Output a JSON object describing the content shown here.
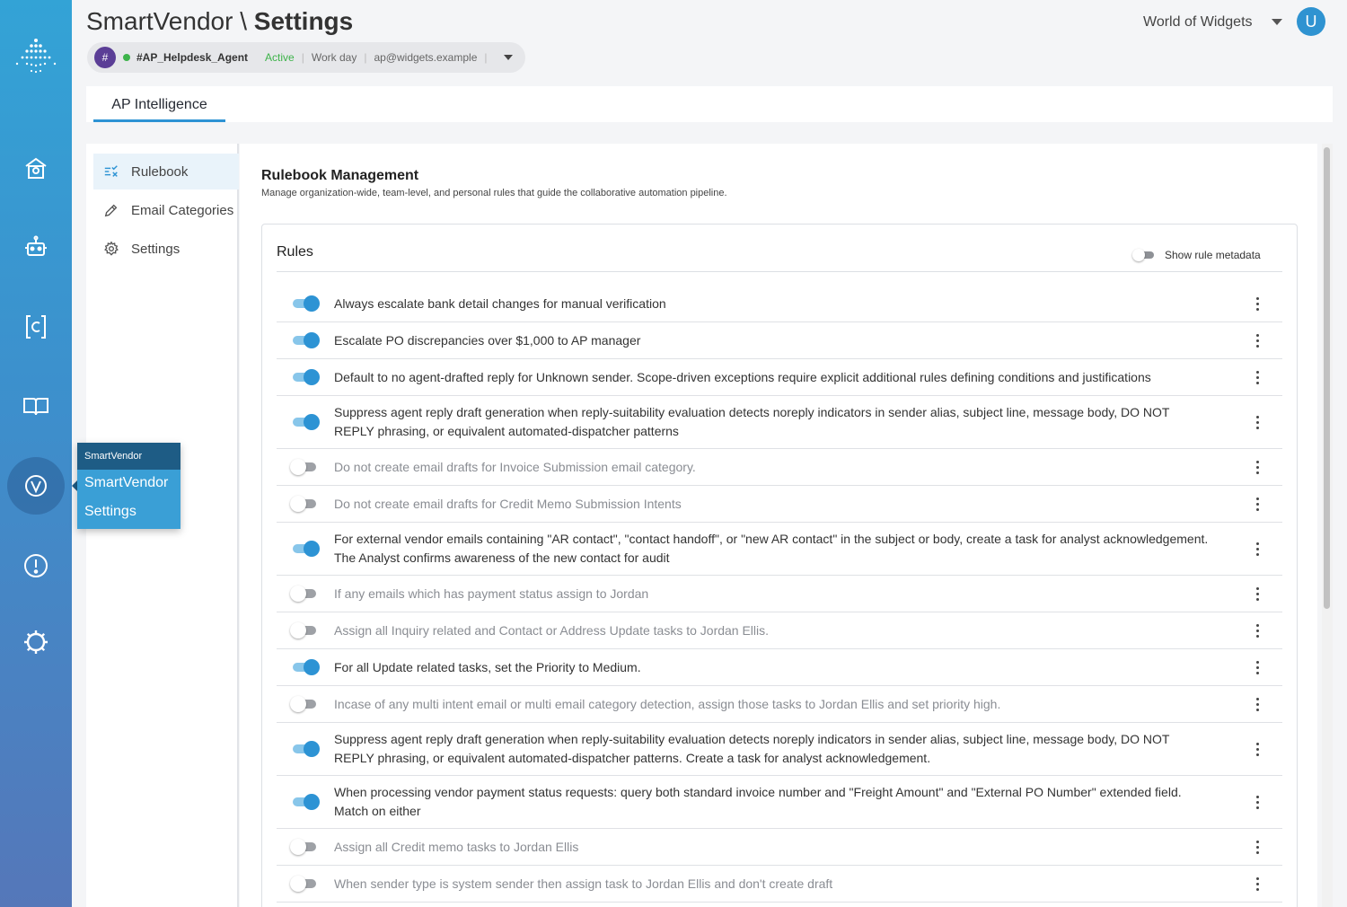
{
  "header": {
    "title_app": "SmartVendor \\",
    "title_page": "Settings",
    "org_name": "World of Widgets",
    "avatar_initial": "U"
  },
  "agent": {
    "icon": "#",
    "name": "#AP_Helpdesk_Agent",
    "status": "Active",
    "schedule": "Work day",
    "email": "ap@widgets.example",
    "sep": "|"
  },
  "tabs": [
    {
      "label": "AP Intelligence"
    }
  ],
  "submenu": [
    {
      "label": "Rulebook",
      "icon": "rulebook-icon"
    },
    {
      "label": "Email Categories",
      "icon": "pencil-icon"
    },
    {
      "label": "Settings",
      "icon": "gear-icon"
    }
  ],
  "flyout": {
    "header": "SmartVendor",
    "items": [
      "SmartVendor",
      "Settings"
    ]
  },
  "main": {
    "heading": "Rulebook Management",
    "description": "Manage organization-wide, team-level, and personal rules that guide the collaborative automation pipeline.",
    "rules_title": "Rules",
    "metadata_label": "Show rule metadata",
    "metadata_enabled": false
  },
  "rules": [
    {
      "text": "Always escalate bank detail changes for manual verification",
      "enabled": true
    },
    {
      "text": "Escalate PO discrepancies over $1,000 to AP manager",
      "enabled": true
    },
    {
      "text": "Default to no agent-drafted reply for Unknown sender. Scope-driven exceptions require explicit additional rules defining conditions and justifications",
      "enabled": true
    },
    {
      "text": "Suppress agent reply draft generation when reply-suitability evaluation detects noreply indicators in sender alias, subject line, message body, DO NOT REPLY phrasing, or equivalent automated-dispatcher patterns",
      "enabled": true
    },
    {
      "text": "Do not create email drafts for Invoice Submission email category.",
      "enabled": false
    },
    {
      "text": "Do not create email drafts for Credit Memo Submission Intents",
      "enabled": false
    },
    {
      "text": "For external vendor emails containing \"AR contact\", \"contact handoff\", or \"new AR contact\" in the subject or body, create a task for analyst acknowledgement. The Analyst confirms awareness of the new contact for audit",
      "enabled": true
    },
    {
      "text": "If any emails which has payment status assign to Jordan",
      "enabled": false
    },
    {
      "text": "Assign all Inquiry related and Contact or Address Update tasks to Jordan Ellis.",
      "enabled": false
    },
    {
      "text": "For all Update related tasks, set the Priority to Medium.",
      "enabled": true
    },
    {
      "text": "Incase of any multi intent email or multi email category detection, assign those tasks to Jordan Ellis and set priority high.",
      "enabled": false
    },
    {
      "text": "Suppress agent reply draft generation when reply-suitability evaluation detects noreply indicators in sender alias, subject line, message body, DO NOT REPLY phrasing, or equivalent automated-dispatcher patterns. Create a task for analyst acknowledgement.",
      "enabled": true
    },
    {
      "text": "When processing vendor payment status requests: query both standard invoice number and \"Freight Amount\" and \"External PO Number\" extended field. Match on either",
      "enabled": true
    },
    {
      "text": "Assign all Credit memo tasks to Jordan Ellis",
      "enabled": false
    },
    {
      "text": "When sender type is system sender then assign task to Jordan Ellis and don't create draft",
      "enabled": false
    }
  ],
  "colors": {
    "accent": "#2d93d4",
    "active_status": "#3db34a",
    "rail_top": "#33a3d6",
    "rail_bottom": "#5577b9"
  }
}
